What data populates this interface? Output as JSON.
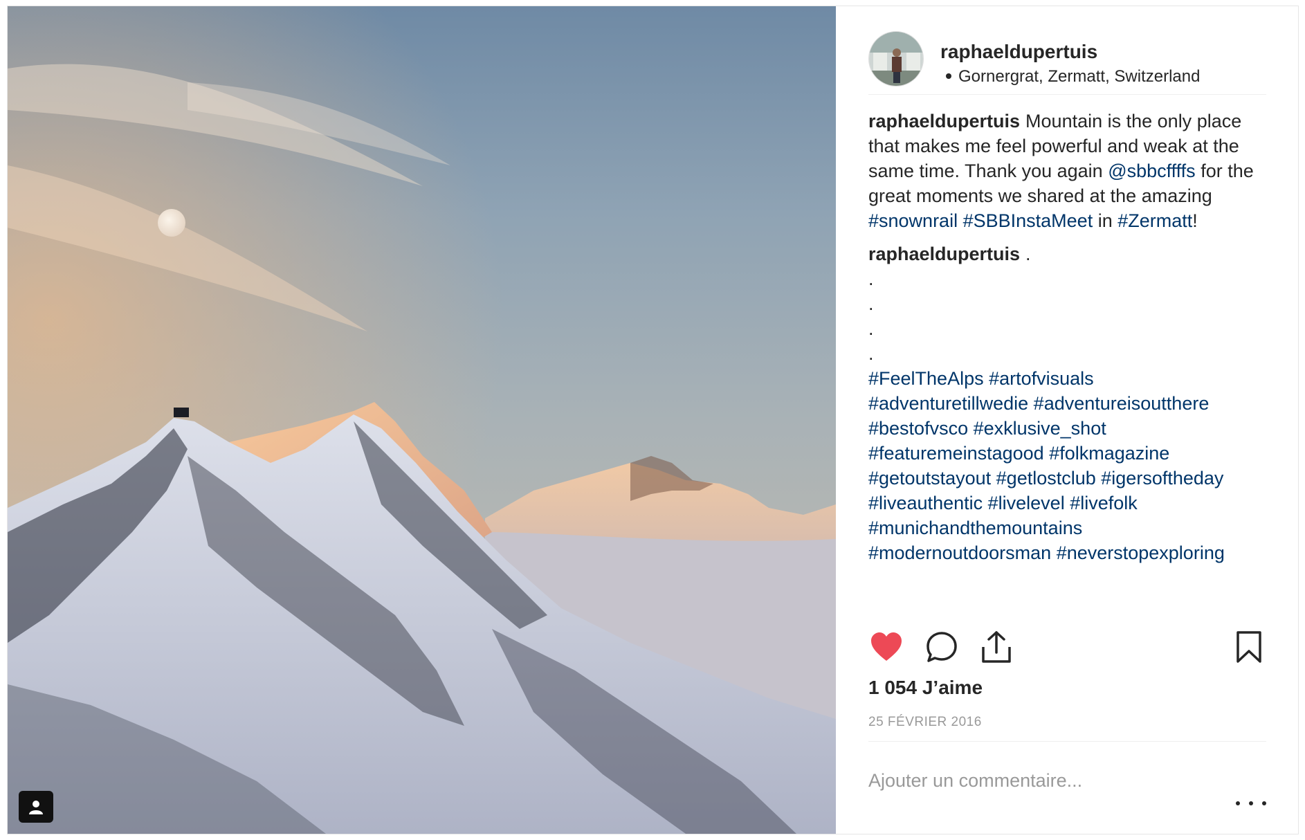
{
  "post": {
    "username": "raphaeldupertuis",
    "location": "Gornergrat, Zermatt, Switzerland"
  },
  "caption": {
    "author": "raphaeldupertuis",
    "text1": "Mountain is the only place that makes me feel powerful and weak at the same time. Thank you again",
    "mention": "@sbbcffffs",
    "text2": "for the great moments we shared at the amazing",
    "tag_snownrail": "#snownrail",
    "tag_sbb": "#SBBInstaMeet",
    "text3": "in",
    "tag_zermatt": "#Zermatt",
    "text4": "!"
  },
  "comment2": {
    "author": "raphaeldupertuis",
    "first_dot": ".",
    "dots": [
      ".",
      ".",
      ".",
      "."
    ],
    "hashtags": [
      "#FeelTheAlps",
      "#artofvisuals",
      "#adventuretillwedie",
      "#adventureisoutthere",
      "#bestofvsco",
      "#exklusive_shot",
      "#featuremeinstagood",
      "#folkmagazine",
      "#getoutstayout",
      "#getlostclub",
      "#igersoftheday",
      "#liveauthentic",
      "#livelevel",
      "#livefolk",
      "#munichandthemountains",
      "#modernoutdoorsman",
      "#neverstopexploring"
    ]
  },
  "actions": {
    "like_icon": "heart-icon",
    "comment_icon": "comment-bubble-icon",
    "share_icon": "share-icon",
    "save_icon": "bookmark-icon",
    "liked": true,
    "like_color": "#ed4956"
  },
  "likes_text": "1 054 J’aime",
  "date_text": "25 FÉVRIER 2016",
  "comment_input": {
    "placeholder": "Ajouter un commentaire..."
  },
  "colors": {
    "link": "#003569",
    "text": "#262626",
    "muted": "#999999"
  }
}
